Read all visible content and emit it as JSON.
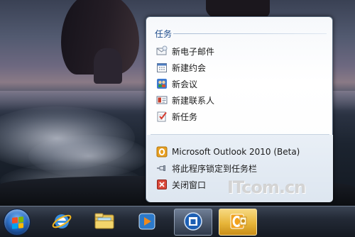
{
  "jumplist": {
    "tasks_title": "任务",
    "tasks": [
      {
        "label": "新电子邮件",
        "icon": "new-email-icon"
      },
      {
        "label": "新建约会",
        "icon": "calendar-icon"
      },
      {
        "label": "新会议",
        "icon": "meeting-icon"
      },
      {
        "label": "新建联系人",
        "icon": "contact-card-icon"
      },
      {
        "label": "新任务",
        "icon": "task-icon"
      }
    ],
    "app_entry": {
      "label": "Microsoft Outlook 2010 (Beta)",
      "icon": "outlook-icon"
    },
    "pin_entry": {
      "label": "将此程序锁定到任务栏",
      "icon": "pin-icon"
    },
    "close_entry": {
      "label": "关闭窗口",
      "icon": "close-window-icon"
    }
  },
  "watermark": "ITcom.cn",
  "taskbar": {
    "items": [
      {
        "name": "internet-explorer",
        "icon": "ie-icon"
      },
      {
        "name": "windows-explorer",
        "icon": "folder-icon"
      },
      {
        "name": "media-player",
        "icon": "media-player-icon"
      },
      {
        "name": "maxthon",
        "icon": "app-window-icon"
      },
      {
        "name": "outlook",
        "icon": "outlook-icon"
      }
    ]
  },
  "colors": {
    "accent_title": "#1f4d8c",
    "outlook_orange": "#e8a021",
    "taskbar": "#232a36"
  }
}
